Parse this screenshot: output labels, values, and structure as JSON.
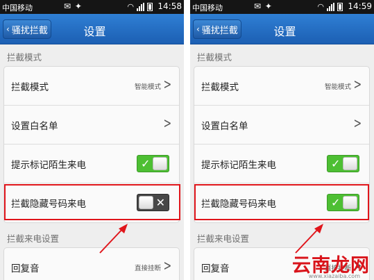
{
  "screens": [
    {
      "status": {
        "carrier": "中国移动",
        "time": "14:58"
      },
      "back_label": "骚扰拦截",
      "title": "设置",
      "section1": "拦截模式",
      "rows": {
        "mode": {
          "label": "拦截模式",
          "value": "智能模式"
        },
        "whitelist": {
          "label": "设置白名单"
        },
        "marked": {
          "label": "提示标记陌生来电",
          "toggle": "on"
        },
        "hidden": {
          "label": "拦截隐藏号码来电",
          "toggle": "off"
        }
      },
      "section2": "拦截来电设置",
      "reply": {
        "label": "回复音",
        "value": "直接挂断"
      }
    },
    {
      "status": {
        "carrier": "中国移动",
        "time": "14:59"
      },
      "back_label": "骚扰拦截",
      "title": "设置",
      "section1": "拦截模式",
      "rows": {
        "mode": {
          "label": "拦截模式",
          "value": "智能模式"
        },
        "whitelist": {
          "label": "设置白名单"
        },
        "marked": {
          "label": "提示标记陌生来电",
          "toggle": "on"
        },
        "hidden": {
          "label": "拦截隐藏号码来电",
          "toggle": "on"
        }
      },
      "section2": "拦截来电设置",
      "reply": {
        "label": "回复音",
        "value": "直接挂断"
      }
    }
  ],
  "icons": {
    "back": "chevron-left-icon",
    "row_arrow": "chevron-right-icon",
    "toggle_on": "check-icon",
    "toggle_off": "x-icon"
  },
  "colors": {
    "titlebar": "#1f66bb",
    "toggle_on": "#4dbf33",
    "toggle_off": "#474747",
    "highlight": "#e0151b"
  },
  "watermark": {
    "text": "云南龙网",
    "url": "www.xiazaiba.com"
  }
}
